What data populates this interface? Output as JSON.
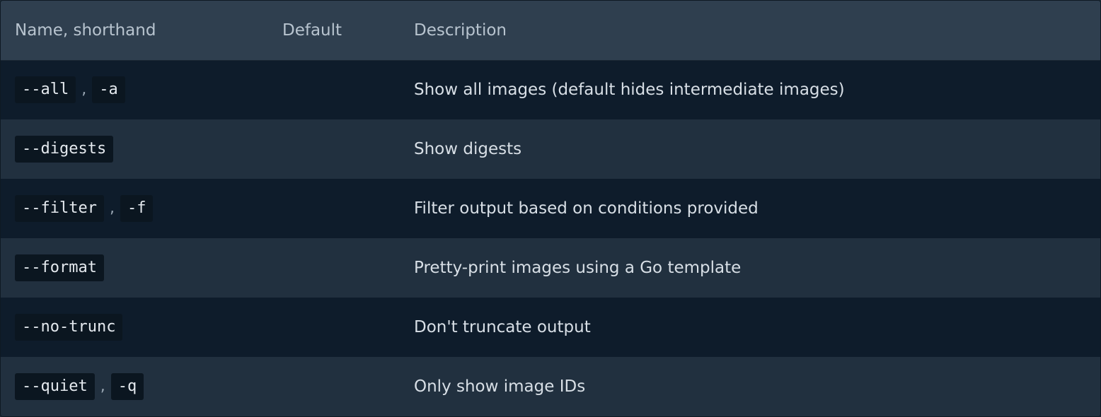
{
  "table": {
    "headers": {
      "name": "Name, shorthand",
      "default": "Default",
      "description": "Description"
    },
    "separator": ",",
    "rows": [
      {
        "flag": "--all",
        "short": "-a",
        "default": "",
        "description": "Show all images (default hides intermediate images)"
      },
      {
        "flag": "--digests",
        "short": "",
        "default": "",
        "description": "Show digests"
      },
      {
        "flag": "--filter",
        "short": "-f",
        "default": "",
        "description": "Filter output based on conditions provided"
      },
      {
        "flag": "--format",
        "short": "",
        "default": "",
        "description": "Pretty-print images using a Go template"
      },
      {
        "flag": "--no-trunc",
        "short": "",
        "default": "",
        "description": "Don't truncate output"
      },
      {
        "flag": "--quiet",
        "short": "-q",
        "default": "",
        "description": "Only show image IDs"
      }
    ]
  },
  "colors": {
    "header_bg": "#2f3f4f",
    "row_dark": "#0e1c2b",
    "row_light": "#21303f",
    "code_bg": "#0b1620"
  }
}
